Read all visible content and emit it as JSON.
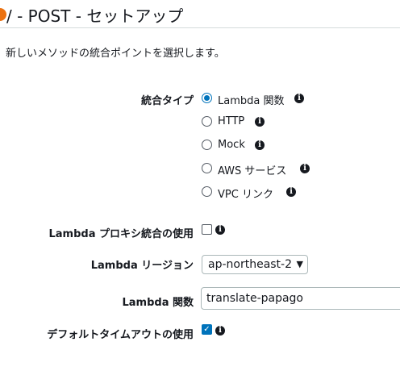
{
  "header": {
    "title": "/ - POST - セットアップ"
  },
  "description": "新しいメソッドの統合ポイントを選択します。",
  "integration_type": {
    "label": "統合タイプ",
    "selected": "Lambda 関数",
    "options": [
      "Lambda 関数",
      "HTTP",
      "Mock",
      "AWS サービス",
      "VPC リンク"
    ]
  },
  "lambda_proxy": {
    "label": "Lambda プロキシ統合の使用",
    "checked": false
  },
  "lambda_region": {
    "label": "Lambda リージョン",
    "value": "ap-northeast-2"
  },
  "lambda_function": {
    "label": "Lambda 関数",
    "value": "translate-papago"
  },
  "default_timeout": {
    "label": "デフォルトタイムアウトの使用",
    "checked": true
  },
  "colors": {
    "accent": "#0073bb",
    "bullet": "#ec7211",
    "text": "#16191f"
  },
  "icons": {
    "info": "info-icon",
    "check": "checkmark-icon",
    "caret": "chevron-down-icon"
  }
}
